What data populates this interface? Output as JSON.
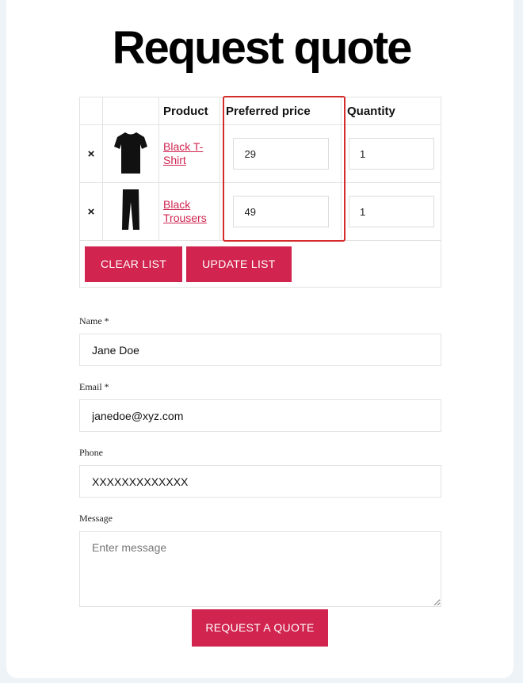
{
  "page": {
    "title": "Request quote"
  },
  "table": {
    "headers": {
      "product": "Product",
      "preferred_price": "Preferred price",
      "quantity": "Quantity"
    },
    "remove_symbol": "×",
    "items": [
      {
        "name_line1": "Black T-",
        "name_line2": "Shirt",
        "image": "black-tshirt-image",
        "price": "29",
        "quantity": "1"
      },
      {
        "name_line1": "Black",
        "name_line2": "Trousers",
        "image": "black-trousers-image",
        "price": "49",
        "quantity": "1"
      }
    ],
    "clear_label": "CLEAR LIST",
    "update_label": "UPDATE LIST"
  },
  "form": {
    "name_label": "Name *",
    "name_value": "Jane Doe",
    "email_label": "Email *",
    "email_value": "janedoe@xyz.com",
    "phone_label": "Phone",
    "phone_value": "XXXXXXXXXXXXX",
    "message_label": "Message",
    "message_placeholder": "Enter message",
    "submit_label": "REQUEST A QUOTE"
  },
  "colors": {
    "accent": "#d1244f",
    "highlight": "#d42b2b",
    "link": "#d0244f"
  }
}
